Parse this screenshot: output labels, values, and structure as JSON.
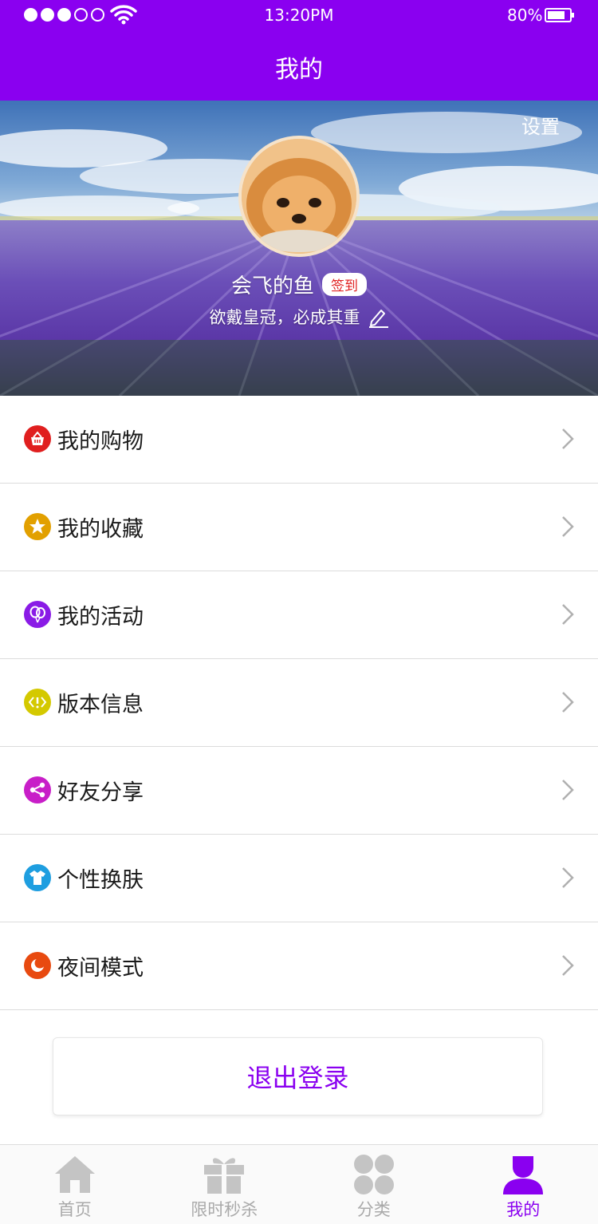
{
  "status_bar": {
    "time": "13:20PM",
    "battery_text": "80%",
    "battery_level": 0.8,
    "signal_dots_filled": 3,
    "signal_dots_total": 5
  },
  "nav": {
    "title": "我的"
  },
  "profile": {
    "settings_label": "设置",
    "username": "会飞的鱼",
    "signin_label": "签到",
    "motto": "欲戴皇冠，必成其重"
  },
  "menu": {
    "items": [
      {
        "label": "我的购物",
        "icon": "shopping-basket-icon",
        "color": "#e01f1f"
      },
      {
        "label": "我的收藏",
        "icon": "star-icon",
        "color": "#e2a000"
      },
      {
        "label": "我的活动",
        "icon": "balloon-icon",
        "color": "#8a1be6"
      },
      {
        "label": "版本信息",
        "icon": "code-icon",
        "color": "#d4c900"
      },
      {
        "label": "好友分享",
        "icon": "share-icon",
        "color": "#c81ec8"
      },
      {
        "label": "个性换肤",
        "icon": "shirt-icon",
        "color": "#1e9ee0"
      },
      {
        "label": "夜间模式",
        "icon": "moon-icon",
        "color": "#e84a10"
      }
    ]
  },
  "logout_label": "退出登录",
  "tabbar": {
    "tabs": [
      {
        "label": "首页",
        "icon": "home-icon",
        "active": false
      },
      {
        "label": "限时秒杀",
        "icon": "gift-icon",
        "active": false
      },
      {
        "label": "分类",
        "icon": "grid-icon",
        "active": false
      },
      {
        "label": "我的",
        "icon": "user-icon",
        "active": true
      }
    ]
  },
  "colors": {
    "brand": "#8a00f0",
    "inactive": "#a9a9a9"
  }
}
